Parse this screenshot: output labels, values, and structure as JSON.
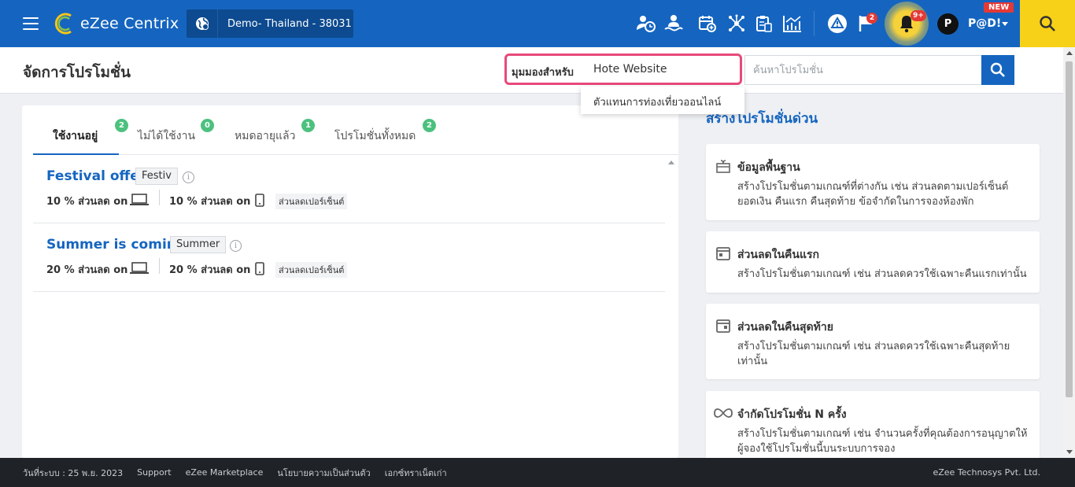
{
  "app": {
    "brand": "eZee Centrix",
    "property": "Demo- Thailand -  38031"
  },
  "colors": {
    "primary": "#1565c0",
    "accent_yellow": "#f7d117",
    "badge_red": "#e53935",
    "tab_count_green": "#4cc17e",
    "highlight_pink": "#e8497a"
  },
  "topbar": {
    "icons": [
      "user-clock-icon",
      "user-wave-icon",
      "calendar-add-icon",
      "network-icon",
      "clipboard-icon",
      "analytics-icon",
      "alert-triangle-icon",
      "flag-icon",
      "bell-icon",
      "search-icon"
    ],
    "flag_badge": "2",
    "bell_badge": "9+",
    "user_initial": "P",
    "user_name": "P@D!",
    "new_label": "NEW"
  },
  "header": {
    "title": "จัดการโปรโมชั่น",
    "view_label": "มุมมองสำหรับ",
    "view_selected": "Hote Website",
    "dropdown_option": "ตัวแทนการท่องเที่ยวออนไลน์",
    "search_placeholder": "ค้นหาโปรโมชั่น"
  },
  "tabs": [
    {
      "label": "ใช้งานอยู่",
      "count": "2",
      "active": true
    },
    {
      "label": "ไม่ได้ใช้งาน",
      "count": "0",
      "active": false
    },
    {
      "label": "หมดอายุแล้ว",
      "count": "1",
      "active": false
    },
    {
      "label": "โปรโมชั่นทั้งหมด",
      "count": "2",
      "active": false
    }
  ],
  "promotions": [
    {
      "name": "Festival offer",
      "code": "Festiv",
      "desktop_discount": "10 % ส่วนลด on",
      "mobile_discount": "10 % ส่วนลด on",
      "type": "ส่วนลดเปอร์เซ็นต์"
    },
    {
      "name": "Summer is coming",
      "code": "Summer",
      "desktop_discount": "20 % ส่วนลด on",
      "mobile_discount": "20 % ส่วนลด on",
      "type": "ส่วนลดเปอร์เซ็นต์"
    }
  ],
  "quick": {
    "title": "สร้างโปรโมชั่นด่วน",
    "cards": [
      {
        "icon": "gift-icon",
        "title": "ข้อมูลพื้นฐาน",
        "desc": "สร้างโปรโมชั่นตามเกณฑ์ที่ต่างกัน เช่น ส่วนลดตามเปอร์เซ็นต์ ยอดเงิน คืนแรก คืนสุดท้าย ข้อจำกัดในการจองห้องพัก"
      },
      {
        "icon": "calendar-first-icon",
        "title": "ส่วนลดในคืนแรก",
        "desc": "สร้างโปรโมชั่นตามเกณฑ์ เช่น ส่วนลดควรใช้เฉพาะคืนแรกเท่านั้น"
      },
      {
        "icon": "calendar-last-icon",
        "title": "ส่วนลดในคืนสุดท้าย",
        "desc": "สร้างโปรโมชั่นตามเกณฑ์ เช่น ส่วนลดควรใช้เฉพาะคืนสุดท้ายเท่านั้น"
      },
      {
        "icon": "infinity-icon",
        "title": "จำกัดโปรโมชั่น N ครั้ง",
        "desc": "สร้างโปรโมชั่นตามเกณฑ์ เช่น จำนวนครั้งที่คุณต้องการอนุญาตให้ผู้จองใช้โปรโมชั่นนี้บนระบบการจอง"
      }
    ]
  },
  "footer": {
    "date": "วันที่ระบบ : 25 พ.ย. 2023",
    "links": [
      "Support",
      "eZee Marketplace",
      "นโยบายความเป็นส่วนตัว",
      "เอกซ์ทราเน็ตเก่า"
    ],
    "copyright": "eZee Technosys Pvt. Ltd."
  }
}
